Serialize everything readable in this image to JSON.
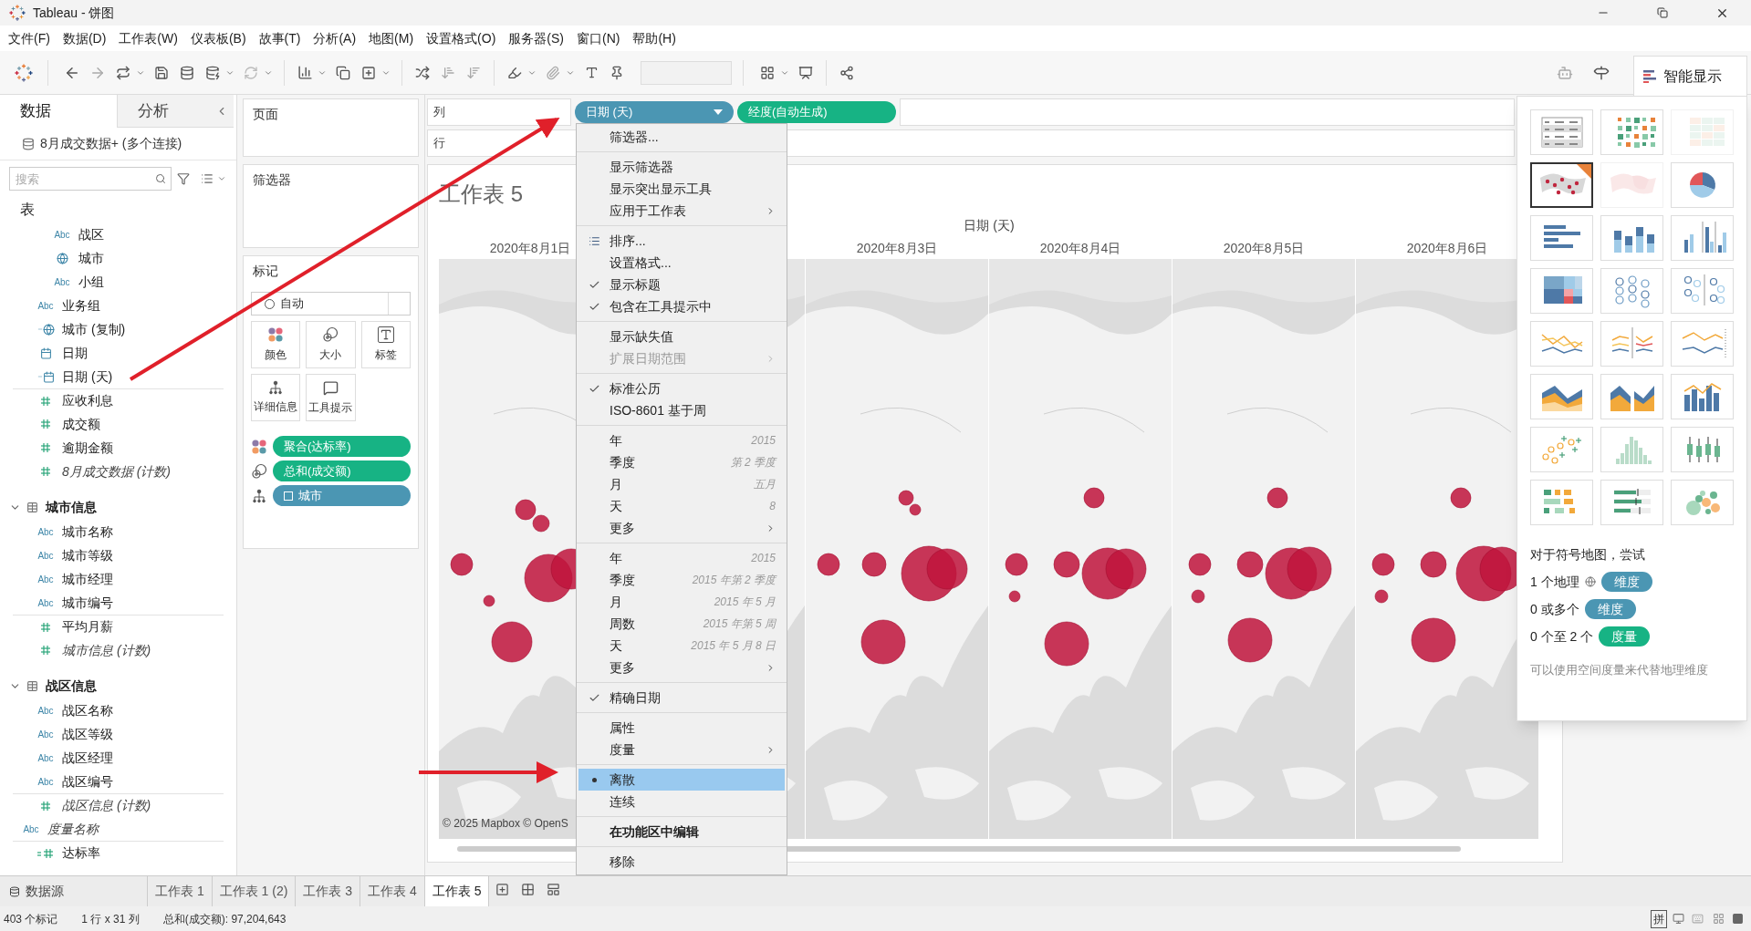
{
  "window": {
    "title": "Tableau - 饼图"
  },
  "menu_bar": [
    "文件(F)",
    "数据(D)",
    "工作表(W)",
    "仪表板(B)",
    "故事(T)",
    "分析(A)",
    "地图(M)",
    "设置格式(O)",
    "服务器(S)",
    "窗口(N)",
    "帮助(H)"
  ],
  "data_pane": {
    "tabs": [
      {
        "label": "数据",
        "selected": true
      },
      {
        "label": "分析",
        "selected": false
      }
    ],
    "source": "8月成交数据+ (多个连接)",
    "search": {
      "placeholder": "搜索"
    },
    "tree": [
      {
        "label": "表",
        "kind": "folder",
        "children": [
          {
            "kind": "hierarchy",
            "children": [
              {
                "label": "战区",
                "kind": "text",
                "badge": "Abc"
              },
              {
                "label": "城市",
                "kind": "geo"
              },
              {
                "label": "小组",
                "kind": "text",
                "badge": "Abc"
              }
            ]
          },
          {
            "label": "业务组",
            "kind": "text",
            "badge": "Abc"
          },
          {
            "label": "城市 (复制)",
            "kind": "geo_calc"
          },
          {
            "label": "日期",
            "kind": "date"
          },
          {
            "label": "日期 (天)",
            "kind": "date_calc"
          },
          {
            "label": "应收利息",
            "kind": "number"
          },
          {
            "label": "成交额",
            "kind": "number"
          },
          {
            "label": "逾期金额",
            "kind": "number"
          },
          {
            "label": "8月成交数据 (计数)",
            "kind": "count"
          }
        ]
      },
      {
        "label": "城市信息",
        "kind": "table",
        "expanded": true,
        "children": [
          {
            "label": "城市名称",
            "kind": "text",
            "badge": "Abc"
          },
          {
            "label": "城市等级",
            "kind": "text",
            "badge": "Abc"
          },
          {
            "label": "城市经理",
            "kind": "text",
            "badge": "Abc"
          },
          {
            "label": "城市编号",
            "kind": "text",
            "badge": "Abc"
          },
          {
            "label": "平均月薪",
            "kind": "number"
          },
          {
            "label": "城市信息 (计数)",
            "kind": "count"
          }
        ]
      },
      {
        "label": "战区信息",
        "kind": "table",
        "expanded": true,
        "children": [
          {
            "label": "战区名称",
            "kind": "text",
            "badge": "Abc"
          },
          {
            "label": "战区等级",
            "kind": "text",
            "badge": "Abc"
          },
          {
            "label": "战区经理",
            "kind": "text",
            "badge": "Abc"
          },
          {
            "label": "战区编号",
            "kind": "text",
            "badge": "Abc"
          },
          {
            "label": "战区信息 (计数)",
            "kind": "count"
          }
        ]
      },
      {
        "label": "度量名称",
        "kind": "measure_names",
        "badge": "Abc"
      },
      {
        "label": "达标率",
        "kind": "number_calc"
      }
    ]
  },
  "cards": {
    "pages": "页面",
    "filters": "筛选器",
    "marks": {
      "title": "标记",
      "mark_type": "自动",
      "buttons": [
        {
          "label": "颜色",
          "kind": "color"
        },
        {
          "label": "大小",
          "kind": "size"
        },
        {
          "label": "标签",
          "kind": "label"
        },
        {
          "label": "详细信息",
          "kind": "detail"
        },
        {
          "label": "工具提示",
          "kind": "tooltip"
        }
      ],
      "encodings": [
        {
          "kind": "color",
          "pill": {
            "label": "聚合(达标率)",
            "kind": "measure",
            "expandable": false
          }
        },
        {
          "kind": "size",
          "pill": {
            "label": "总和(成交额)",
            "kind": "measure",
            "expandable": false
          }
        },
        {
          "kind": "detail",
          "pill": {
            "label": "城市",
            "kind": "dimension",
            "expandable": true
          }
        }
      ]
    }
  },
  "shelves": {
    "columns": {
      "label": "列",
      "pills": [
        {
          "label": "日期 (天)",
          "kind": "dimension",
          "dropdown": true
        },
        {
          "label": "经度(自动生成)",
          "kind": "measure",
          "dropdown": false
        }
      ]
    },
    "rows": {
      "label": "行"
    }
  },
  "view": {
    "title": "工作表 5",
    "header": "日期 (天)",
    "attribution": "© 2025 Mapbox © OpenS",
    "panels": [
      {
        "kind": "picture",
        "date": "2020年8月1日"
      },
      {
        "kind": "picture"
      },
      {
        "kind": "picture",
        "date": "2020年8月3日"
      },
      {
        "kind": "picture",
        "date": "2020年8月4日"
      },
      {
        "kind": "picture",
        "date": "2020年8月5日"
      },
      {
        "kind": "picture",
        "date": "2020年8月6日"
      }
    ]
  },
  "context_menu": {
    "groups": [
      {
        "items": [
          {
            "label": "筛选器...",
            "kind": "check",
            "checked": false,
            "submenu": false,
            "disabled": false,
            "selected": false,
            "bold": false
          }
        ]
      },
      {
        "items": [
          {
            "label": "显示筛选器",
            "kind": "check",
            "checked": false,
            "submenu": false,
            "disabled": false,
            "selected": false,
            "bold": false
          },
          {
            "label": "显示突出显示工具",
            "kind": "check",
            "checked": false,
            "submenu": false,
            "disabled": false,
            "selected": false,
            "bold": false
          },
          {
            "label": "应用于工作表",
            "kind": "check",
            "checked": false,
            "submenu": true,
            "disabled": false,
            "selected": false,
            "bold": false
          }
        ]
      },
      {
        "items": [
          {
            "label": "排序...",
            "kind": "sort",
            "checked": false,
            "submenu": false,
            "disabled": false,
            "selected": false,
            "bold": false
          },
          {
            "label": "设置格式...",
            "kind": "check",
            "checked": false,
            "submenu": false,
            "disabled": false,
            "selected": false,
            "bold": false
          },
          {
            "label": "显示标题",
            "kind": "check",
            "checked": true,
            "submenu": false,
            "disabled": false,
            "selected": false,
            "bold": false
          },
          {
            "label": "包含在工具提示中",
            "kind": "check",
            "checked": true,
            "submenu": false,
            "disabled": false,
            "selected": false,
            "bold": false
          }
        ]
      },
      {
        "items": [
          {
            "label": "显示缺失值",
            "kind": "check",
            "checked": false,
            "submenu": false,
            "disabled": false,
            "selected": false,
            "bold": false
          },
          {
            "label": "扩展日期范围",
            "kind": "check",
            "checked": false,
            "submenu": true,
            "disabled": true,
            "selected": false,
            "bold": false
          }
        ]
      },
      {
        "items": [
          {
            "label": "标准公历",
            "kind": "check",
            "checked": true,
            "submenu": false,
            "disabled": false,
            "selected": false,
            "bold": false
          },
          {
            "label": "ISO-8601 基于周",
            "kind": "check",
            "checked": false,
            "submenu": false,
            "disabled": false,
            "selected": false,
            "bold": false
          }
        ]
      },
      {
        "items": [
          {
            "label": "年",
            "hint": "2015",
            "kind": "check",
            "checked": false,
            "submenu": false,
            "disabled": false,
            "selected": false,
            "bold": false
          },
          {
            "label": "季度",
            "hint": "第 2 季度",
            "kind": "check",
            "checked": false,
            "submenu": false,
            "disabled": false,
            "selected": false,
            "bold": false
          },
          {
            "label": "月",
            "hint": "五月",
            "kind": "check",
            "checked": false,
            "submenu": false,
            "disabled": false,
            "selected": false,
            "bold": false
          },
          {
            "label": "天",
            "hint": "8",
            "kind": "check",
            "checked": false,
            "submenu": false,
            "disabled": false,
            "selected": false,
            "bold": false
          },
          {
            "label": "更多",
            "kind": "check",
            "checked": false,
            "submenu": true,
            "disabled": false,
            "selected": false,
            "bold": false
          }
        ]
      },
      {
        "items": [
          {
            "label": "年",
            "hint": "2015",
            "kind": "check",
            "checked": false,
            "submenu": false,
            "disabled": false,
            "selected": false,
            "bold": false
          },
          {
            "label": "季度",
            "hint": "2015 年第 2 季度",
            "kind": "check",
            "checked": false,
            "submenu": false,
            "disabled": false,
            "selected": false,
            "bold": false
          },
          {
            "label": "月",
            "hint": "2015 年 5 月",
            "kind": "check",
            "checked": false,
            "submenu": false,
            "disabled": false,
            "selected": false,
            "bold": false
          },
          {
            "label": "周数",
            "hint": "2015 年第 5 周",
            "kind": "check",
            "checked": false,
            "submenu": false,
            "disabled": false,
            "selected": false,
            "bold": false
          },
          {
            "label": "天",
            "hint": "2015 年 5 月 8 日",
            "kind": "check",
            "checked": false,
            "submenu": false,
            "disabled": false,
            "selected": false,
            "bold": false
          },
          {
            "label": "更多",
            "kind": "check",
            "checked": false,
            "submenu": true,
            "disabled": false,
            "selected": false,
            "bold": false
          }
        ]
      },
      {
        "items": [
          {
            "label": "精确日期",
            "kind": "check",
            "checked": true,
            "submenu": false,
            "disabled": false,
            "selected": false,
            "bold": false
          }
        ]
      },
      {
        "items": [
          {
            "label": "属性",
            "kind": "check",
            "checked": false,
            "submenu": false,
            "disabled": false,
            "selected": false,
            "bold": false
          },
          {
            "label": "度量",
            "kind": "check",
            "checked": false,
            "submenu": true,
            "disabled": false,
            "selected": false,
            "bold": false
          }
        ]
      },
      {
        "items": [
          {
            "label": "离散",
            "kind": "radio",
            "checked": true,
            "submenu": false,
            "disabled": false,
            "selected": true,
            "bold": false
          },
          {
            "label": "连续",
            "kind": "radio",
            "checked": false,
            "submenu": false,
            "disabled": false,
            "selected": false,
            "bold": false
          }
        ]
      },
      {
        "items": [
          {
            "label": "在功能区中编辑",
            "kind": "check",
            "checked": false,
            "submenu": false,
            "disabled": false,
            "selected": false,
            "bold": true
          }
        ]
      },
      {
        "items": [
          {
            "label": "移除",
            "kind": "check",
            "checked": false,
            "submenu": false,
            "disabled": false,
            "selected": false,
            "bold": false
          }
        ]
      }
    ]
  },
  "show_me": {
    "tab": "智能显示",
    "charts": [
      {
        "kind": "text_table",
        "selected": false,
        "disabled": false
      },
      {
        "kind": "heat_map",
        "selected": false,
        "disabled": false
      },
      {
        "kind": "highlight_table",
        "selected": false,
        "disabled": true
      },
      {
        "kind": "symbol_map",
        "selected": true,
        "disabled": false
      },
      {
        "kind": "filled_map",
        "selected": false,
        "disabled": true
      },
      {
        "kind": "pie",
        "selected": false,
        "disabled": false
      },
      {
        "kind": "hbar",
        "selected": false,
        "disabled": false
      },
      {
        "kind": "stacked_bar",
        "selected": false,
        "disabled": false
      },
      {
        "kind": "side_bar",
        "selected": false,
        "disabled": false
      },
      {
        "kind": "treemap",
        "selected": false,
        "disabled": false
      },
      {
        "kind": "circle",
        "selected": false,
        "disabled": false
      },
      {
        "kind": "side_circle",
        "selected": false,
        "disabled": false
      },
      {
        "kind": "line_cont",
        "selected": false,
        "disabled": false
      },
      {
        "kind": "line_disc",
        "selected": false,
        "disabled": false
      },
      {
        "kind": "dual_line",
        "selected": false,
        "disabled": false
      },
      {
        "kind": "area_cont",
        "selected": false,
        "disabled": false
      },
      {
        "kind": "area_disc",
        "selected": false,
        "disabled": false
      },
      {
        "kind": "dual_combo",
        "selected": false,
        "disabled": false
      },
      {
        "kind": "scatter",
        "selected": false,
        "disabled": false
      },
      {
        "kind": "histogram",
        "selected": false,
        "disabled": false
      },
      {
        "kind": "box",
        "selected": false,
        "disabled": false
      },
      {
        "kind": "gantt",
        "selected": false,
        "disabled": false
      },
      {
        "kind": "bullet",
        "selected": false,
        "disabled": false
      },
      {
        "kind": "bubbles",
        "selected": false,
        "disabled": false
      }
    ],
    "hint_title": "对于符号地图，尝试",
    "requirements": [
      {
        "count": "1 个地理",
        "geo": true,
        "pill": "维度",
        "kind": "dimension"
      },
      {
        "count": "0 或多个",
        "geo": false,
        "pill": "维度",
        "kind": "dimension"
      },
      {
        "count": "0 个至 2 个",
        "geo": false,
        "pill": "度量",
        "kind": "measure"
      }
    ],
    "note": "可以使用空间度量来代替地理维度"
  },
  "sheet_tabs": {
    "data_source": "数据源",
    "sheets": [
      {
        "label": "工作表 1",
        "selected": false
      },
      {
        "label": "工作表 1 (2)",
        "selected": false
      },
      {
        "label": "工作表 3",
        "selected": false
      },
      {
        "label": "工作表 4",
        "selected": false
      },
      {
        "label": "工作表 5",
        "selected": true
      }
    ]
  },
  "status_bar": {
    "marks": "403 个标记",
    "dims": "1 行 x 31 列",
    "sum": "总和(成交额): 97,204,643",
    "ime": "拼"
  }
}
